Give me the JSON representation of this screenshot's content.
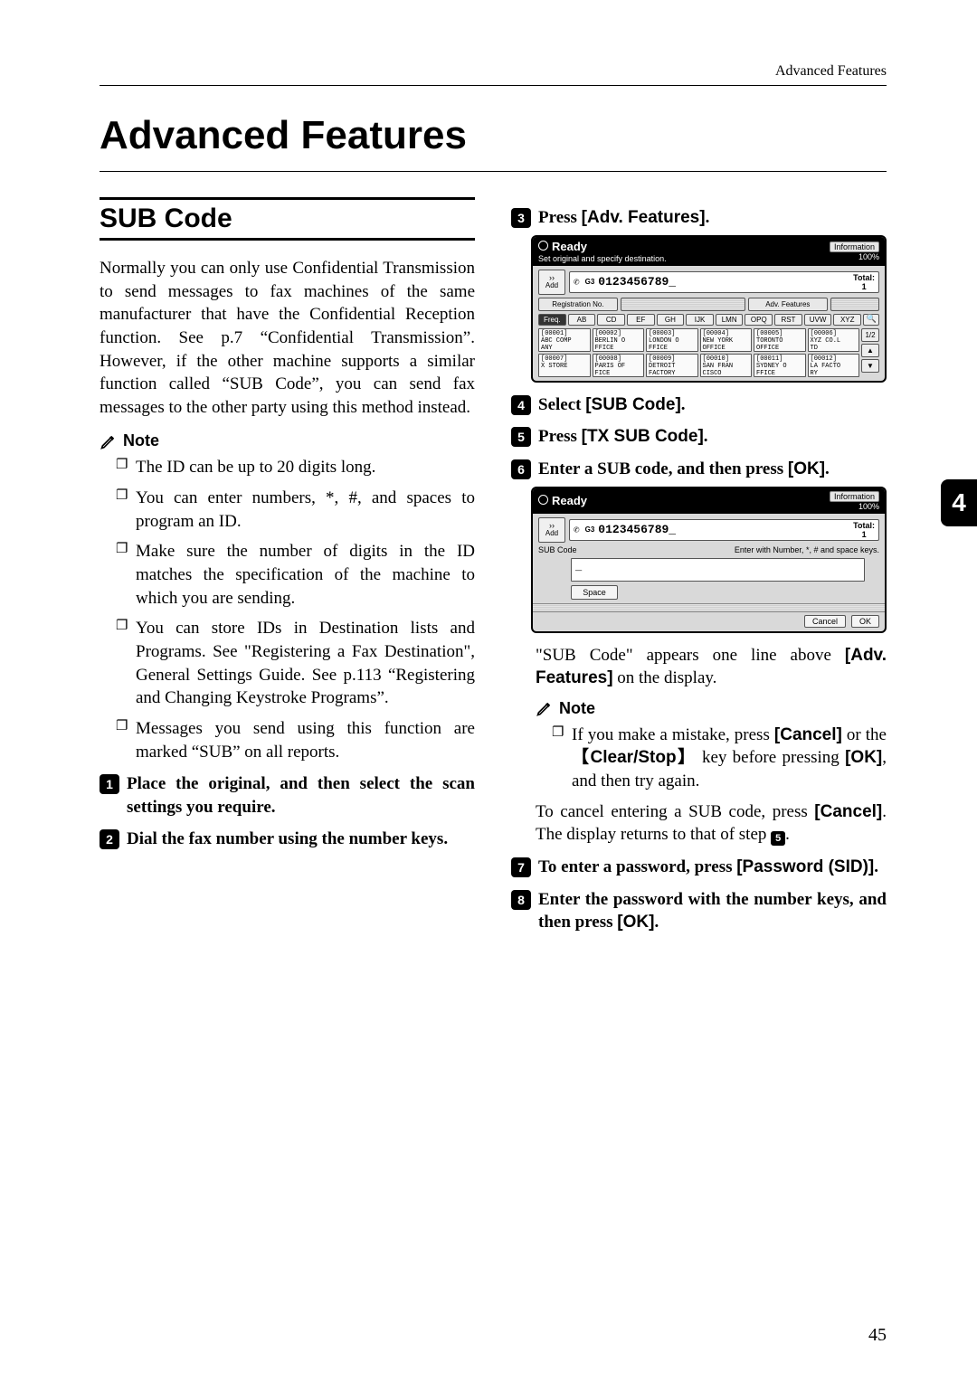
{
  "running_head": "Advanced Features",
  "chapter_title": "Advanced Features",
  "side_tab": "4",
  "page_number": "45",
  "left": {
    "section_title": "SUB Code",
    "intro": "Normally you can only use Confidential Transmission to send messages to fax machines of the same manufacturer that have the Confidential Reception function. See p.7 “Confidential Transmission”. However, if the other machine supports a similar function called “SUB Code”, you can send fax messages to the other party using this method instead.",
    "note_label": "Note",
    "notes": [
      "The ID can be up to 20 digits long.",
      "You can enter numbers, *, #, and spaces to program an ID.",
      "Make sure the number of digits in the ID matches the specification of the machine to which you are sending.",
      "You can store IDs in Destination lists and Programs. See \"Registering a Fax Destination\", General Settings Guide. See p.113 “Registering and Changing Keystroke Programs”.",
      "Messages you send using this function are marked “SUB” on all reports."
    ],
    "step1_num": "1",
    "step1": "Place the original, and then select the scan settings you require.",
    "step2_num": "2",
    "step2": "Dial the fax number using the number keys."
  },
  "right": {
    "step3_num": "3",
    "step3_a": "Press ",
    "step3_ui": "[Adv. Features]",
    "step3_b": ".",
    "step4_num": "4",
    "step4_a": "Select ",
    "step4_ui": "[SUB Code]",
    "step4_b": ".",
    "step5_num": "5",
    "step5_a": "Press ",
    "step5_ui": "[TX SUB Code]",
    "step5_b": ".",
    "step6_num": "6",
    "step6_a": "Enter a SUB code, and then press ",
    "step6_ui": "[OK]",
    "step6_b": ".",
    "after6_a": "\"SUB Code\" appears one line above ",
    "after6_ui": "[Adv. Features]",
    "after6_b": " on the display.",
    "note_label": "Note",
    "note_item_a": "If you make a mistake, press ",
    "note_item_ui1": "[Cancel]",
    "note_item_mid": " or the ",
    "note_item_hw": "Clear/Stop",
    "note_item_mid2": " key before pressing ",
    "note_item_ui2": "[OK]",
    "note_item_end": ", and then try again.",
    "cancel_para_a": "To cancel entering a SUB code, press ",
    "cancel_para_ui": "[Cancel]",
    "cancel_para_b": ". The display returns to that of step ",
    "cancel_para_badge": "5",
    "cancel_para_c": ".",
    "step7_num": "7",
    "step7_a": "To enter a password, press ",
    "step7_ui": "[Password (SID)]",
    "step7_b": ".",
    "step8_num": "8",
    "step8_a": "Enter the password with the number keys, and then press ",
    "step8_ui": "[OK]",
    "step8_b": "."
  },
  "screen1": {
    "ready": "Ready",
    "sub": "Set original and specify destination.",
    "info": "Information",
    "pct": "100%",
    "add": "Add",
    "gs": "G3",
    "dial": "0123456789_",
    "total_label": "Total:",
    "total_value": "1",
    "tab1": "Registration No.",
    "tab2": "Adv. Features",
    "alpha": [
      "Freq.",
      "AB",
      "CD",
      "EF",
      "GH",
      "IJK",
      "LMN",
      "OPQ",
      "RST",
      "UVW",
      "XYZ"
    ],
    "page_ind": "1/2",
    "dest": [
      [
        "[00001]",
        "ABC COMP",
        "ANY"
      ],
      [
        "[00002]",
        "BERLIN O",
        "FFICE"
      ],
      [
        "[00003]",
        "LONDON O",
        "FFICE"
      ],
      [
        "[00004]",
        "NEW YORK",
        " OFFICE"
      ],
      [
        "[00005]",
        "TORONTO",
        "OFFICE"
      ],
      [
        "[00006]",
        "XYZ CO.L",
        "TD"
      ],
      [
        "[00007]",
        "X STORE",
        ""
      ],
      [
        "[00008]",
        "PARIS OF",
        "FICE"
      ],
      [
        "[00009]",
        "DETROIT",
        "FACTORY"
      ],
      [
        "[00010]",
        "SAN FRAN",
        "CISCO"
      ],
      [
        "[00011]",
        "SYDNEY O",
        "FFICE"
      ],
      [
        "[00012]",
        "LA FACTO",
        "RY"
      ]
    ]
  },
  "screen2": {
    "ready": "Ready",
    "info": "Information",
    "pct": "100%",
    "add": "Add",
    "gs": "G3",
    "dial": "0123456789_",
    "total_label": "Total:",
    "total_value": "1",
    "field_label": "SUB Code",
    "hint": "Enter with Number, *, # and space keys.",
    "caret": "_",
    "space": "Space",
    "cancel": "Cancel",
    "ok": "OK"
  }
}
